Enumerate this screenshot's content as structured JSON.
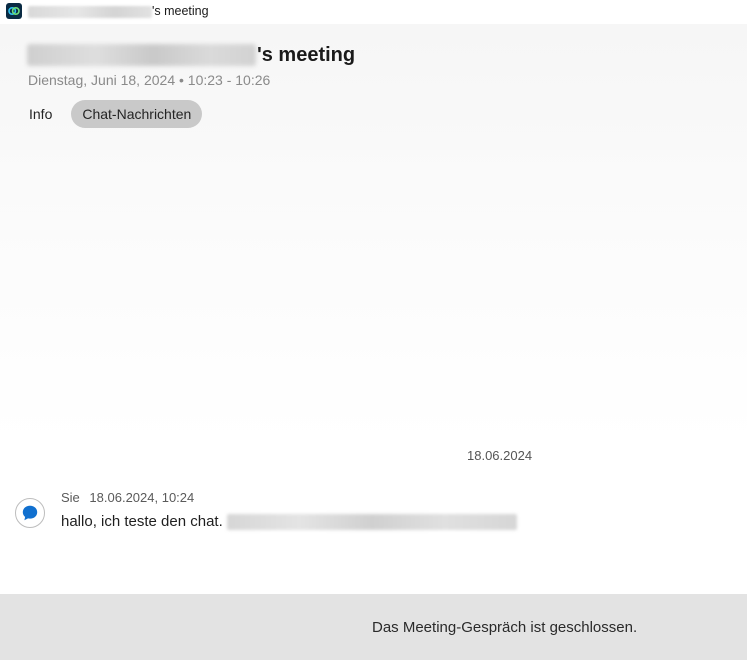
{
  "window": {
    "title_suffix": "'s meeting",
    "app_icon": "webex-app-icon"
  },
  "meeting": {
    "title_suffix": "'s meeting",
    "date": "Dienstag, Juni 18, 2024 • 10:23 - 10:26"
  },
  "tabs": [
    {
      "label": "Info",
      "active": false
    },
    {
      "label": "Chat-Nachrichten",
      "active": true
    }
  ],
  "chat": {
    "date_divider": "18.06.2024",
    "messages": [
      {
        "sender": "Sie",
        "timestamp": "18.06.2024, 10:24",
        "text": "hallo, ich teste den chat.",
        "icon": "chat-bubble-icon"
      }
    ]
  },
  "footer": {
    "status": "Das Meeting-Gespräch ist geschlossen."
  },
  "colors": {
    "active_tab_bg": "#c9c9c9",
    "footer_bg": "#e3e3e3",
    "chat_icon": "#1170cf"
  }
}
